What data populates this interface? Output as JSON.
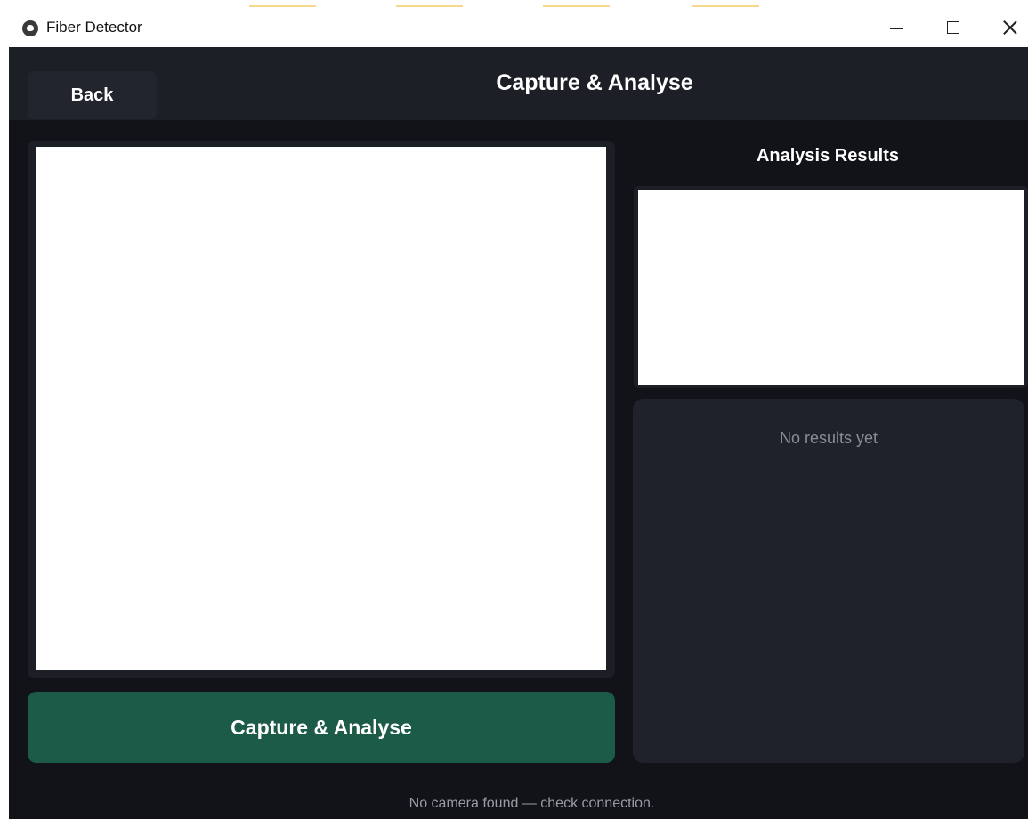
{
  "window": {
    "title": "Fiber Detector"
  },
  "header": {
    "back_label": "Back",
    "title": "Capture & Analyse"
  },
  "camera": {
    "capture_label": "Capture & Analyse"
  },
  "results": {
    "title": "Analysis Results",
    "empty_text": "No results yet"
  },
  "status": {
    "message": "No camera found — check connection."
  },
  "colors": {
    "background": "#111319",
    "panel": "#1c1f26",
    "accent_green": "#1b5b47",
    "muted_text": "#8a8d95"
  }
}
